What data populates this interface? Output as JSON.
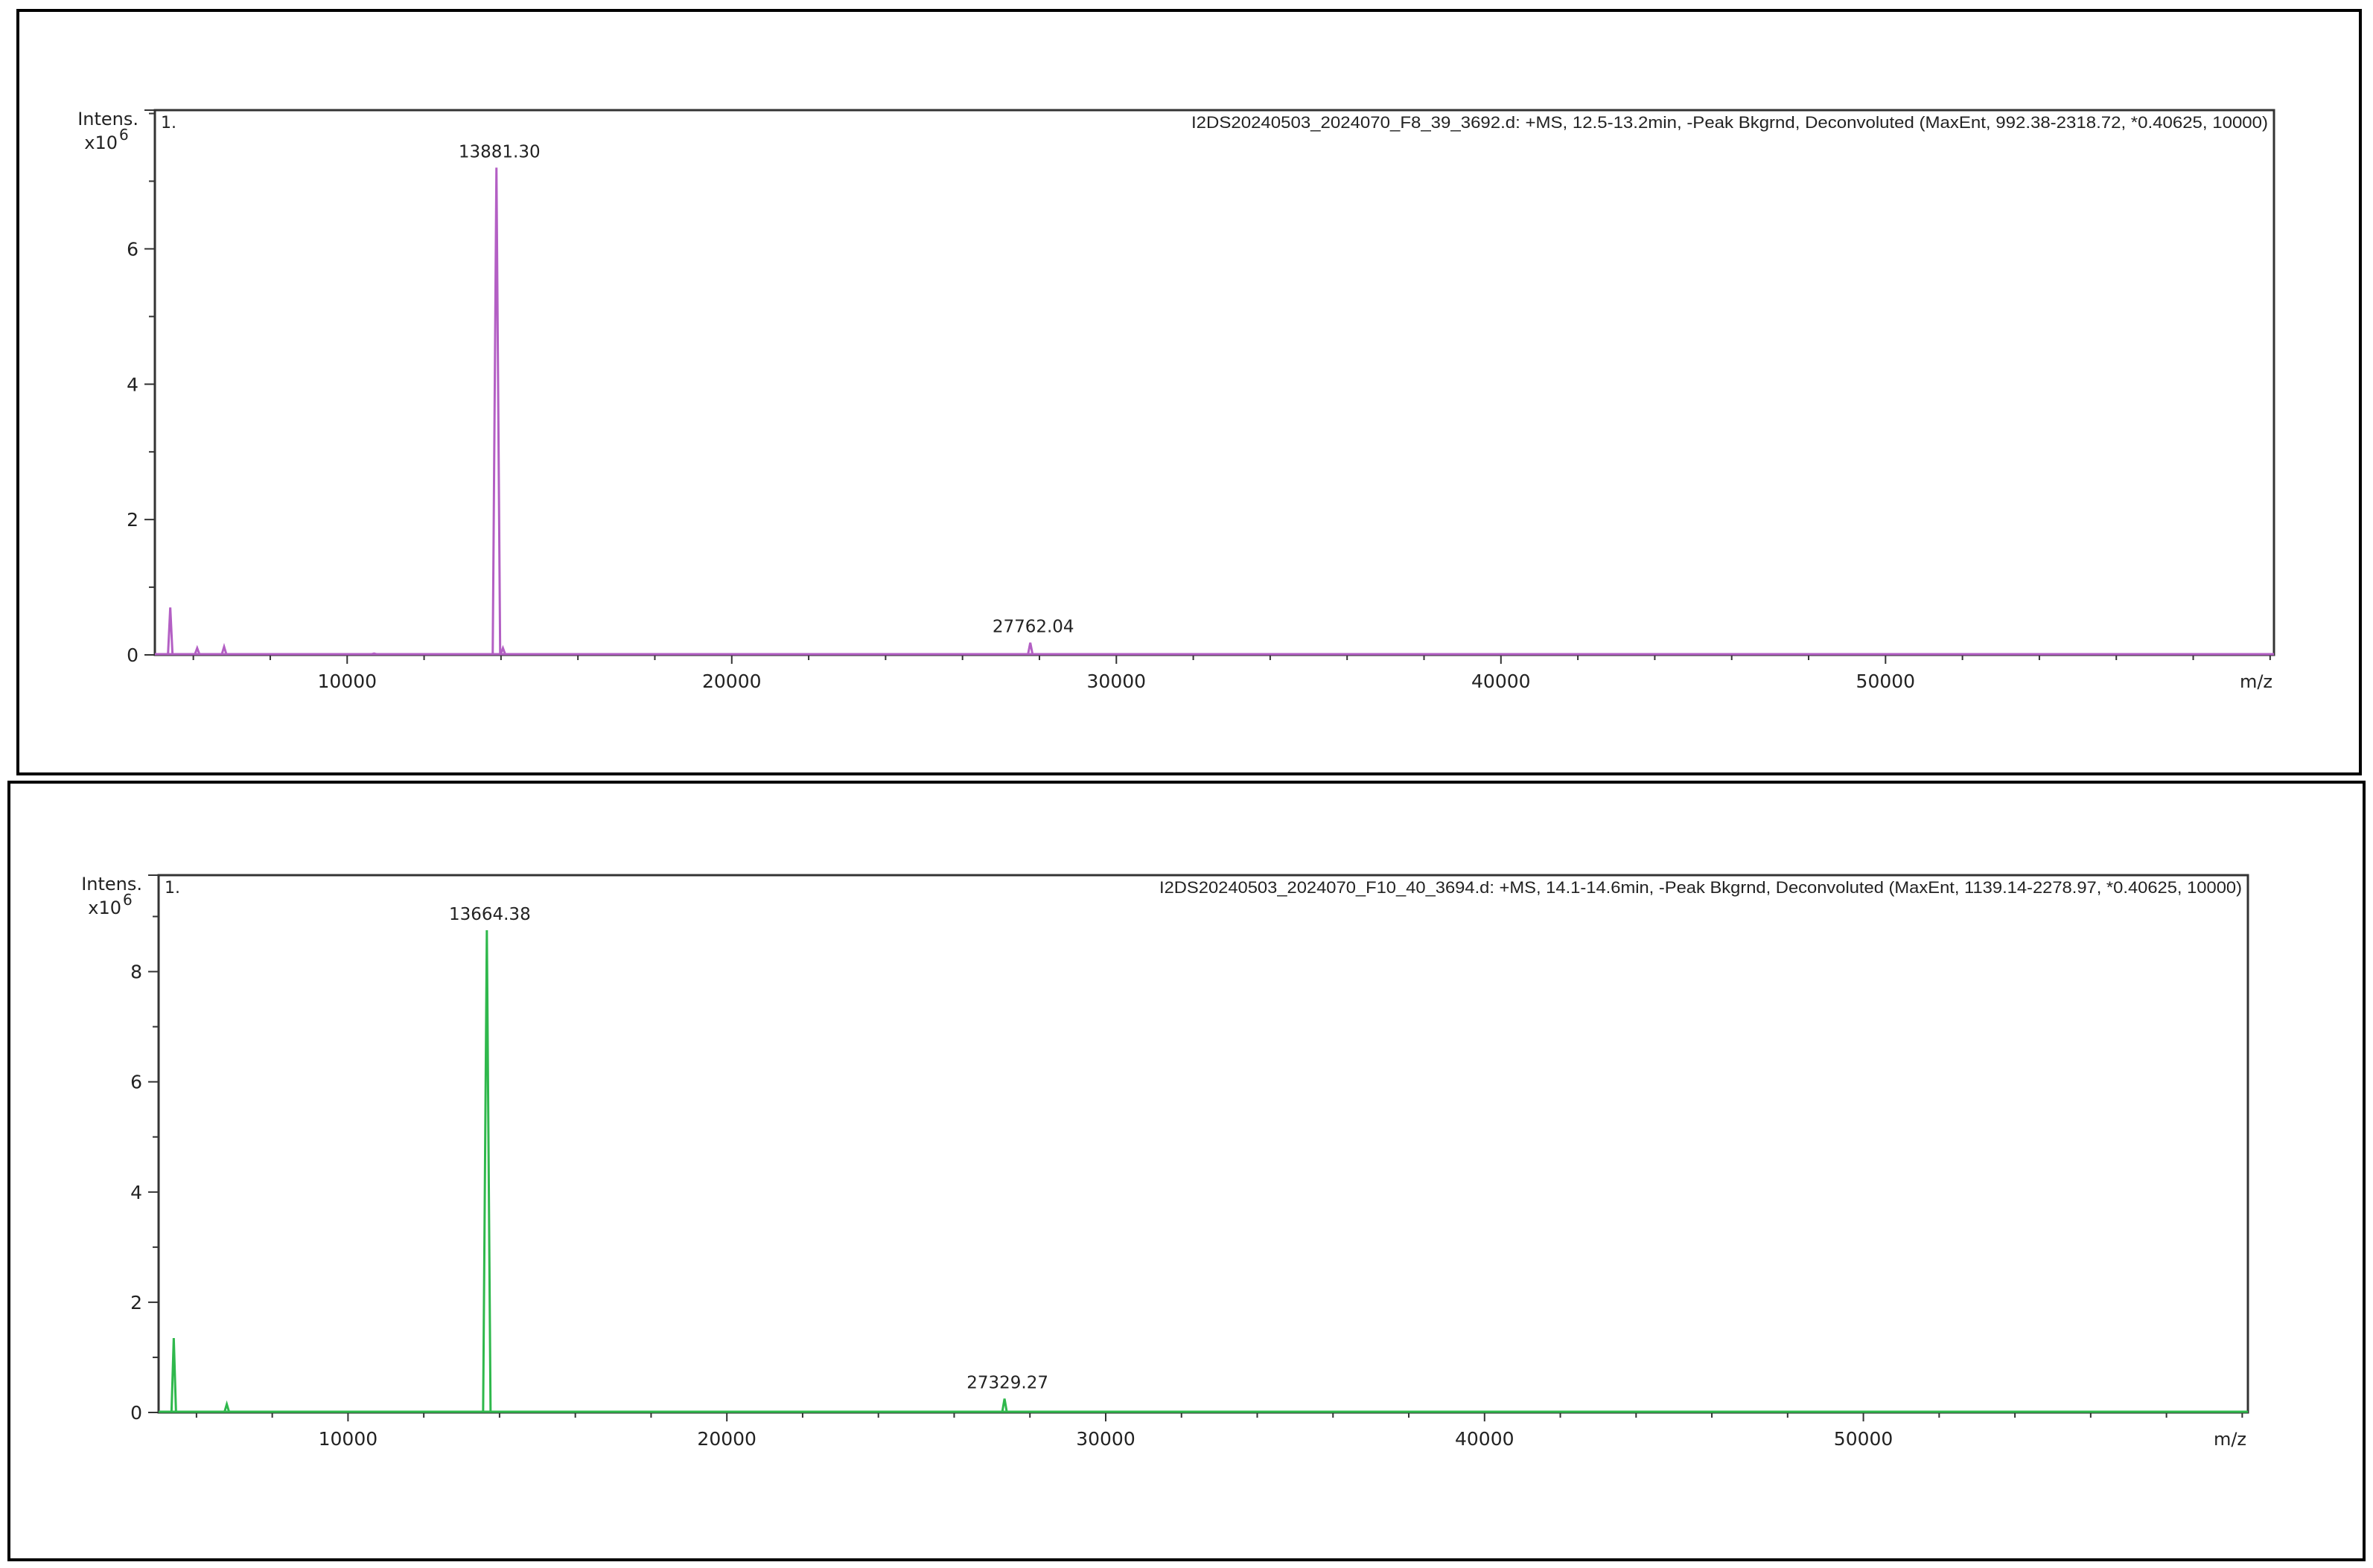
{
  "chart_data": [
    {
      "type": "line",
      "title": "I2DS20240503_2024070_F8_39_3692.d: +MS, 12.5-13.2min, -Peak Bkgrnd, Deconvoluted (MaxEnt, 992.38-2318.72, *0.40625, 10000)",
      "panel_label": "1.",
      "ylabel": "Intens.",
      "yunit": "x10",
      "yexp": "6",
      "xlabel": "m/z",
      "xlim": [
        5000,
        60100
      ],
      "ylim": [
        0,
        8.05
      ],
      "yticks": [
        0,
        2,
        4,
        6
      ],
      "xticks": [
        10000,
        20000,
        30000,
        40000,
        50000
      ],
      "color": "#b35fc4",
      "peaks": [
        {
          "x": 5400,
          "y": 0.7
        },
        {
          "x": 6100,
          "y": 0.1
        },
        {
          "x": 6800,
          "y": 0.12
        },
        {
          "x": 10700,
          "y": 0.02
        },
        {
          "x": 13881.3,
          "y": 7.2,
          "label": "13881.30"
        },
        {
          "x": 14050,
          "y": 0.1
        },
        {
          "x": 27762.04,
          "y": 0.18,
          "label": "27762.04"
        }
      ]
    },
    {
      "type": "line",
      "title": "I2DS20240503_2024070_F10_40_3694.d: +MS, 14.1-14.6min, -Peak Bkgrnd, Deconvoluted (MaxEnt, 1139.14-2278.97, *0.40625, 10000)",
      "panel_label": "1.",
      "ylabel": "Intens.",
      "yunit": "x10",
      "yexp": "6",
      "xlabel": "m/z",
      "xlim": [
        5000,
        60150
      ],
      "ylim": [
        0,
        9.75
      ],
      "yticks": [
        0,
        2,
        4,
        6,
        8
      ],
      "xticks": [
        10000,
        20000,
        30000,
        40000,
        50000
      ],
      "color": "#2fb84c",
      "peaks": [
        {
          "x": 5400,
          "y": 1.35
        },
        {
          "x": 6800,
          "y": 0.15
        },
        {
          "x": 13664.38,
          "y": 8.75,
          "label": "13664.38"
        },
        {
          "x": 27329.27,
          "y": 0.25,
          "label": "27329.27"
        }
      ]
    }
  ]
}
